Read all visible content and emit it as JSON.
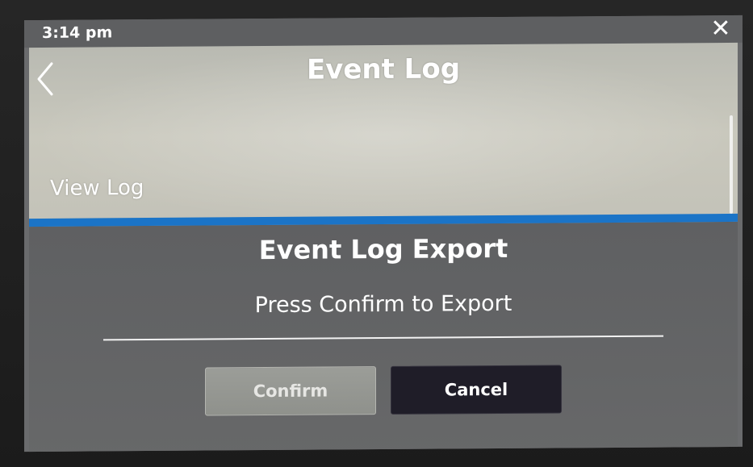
{
  "status_bar": {
    "time": "3:14 pm",
    "close_glyph": "✕"
  },
  "header": {
    "title": "Event Log",
    "back_icon": "chevron-left-icon"
  },
  "list": {
    "items": [
      {
        "label": "View Log"
      }
    ]
  },
  "dialog": {
    "title": "Event Log Export",
    "message": "Press Confirm to Export",
    "confirm_label": "Confirm",
    "cancel_label": "Cancel",
    "accent_color": "#1b74c7"
  }
}
